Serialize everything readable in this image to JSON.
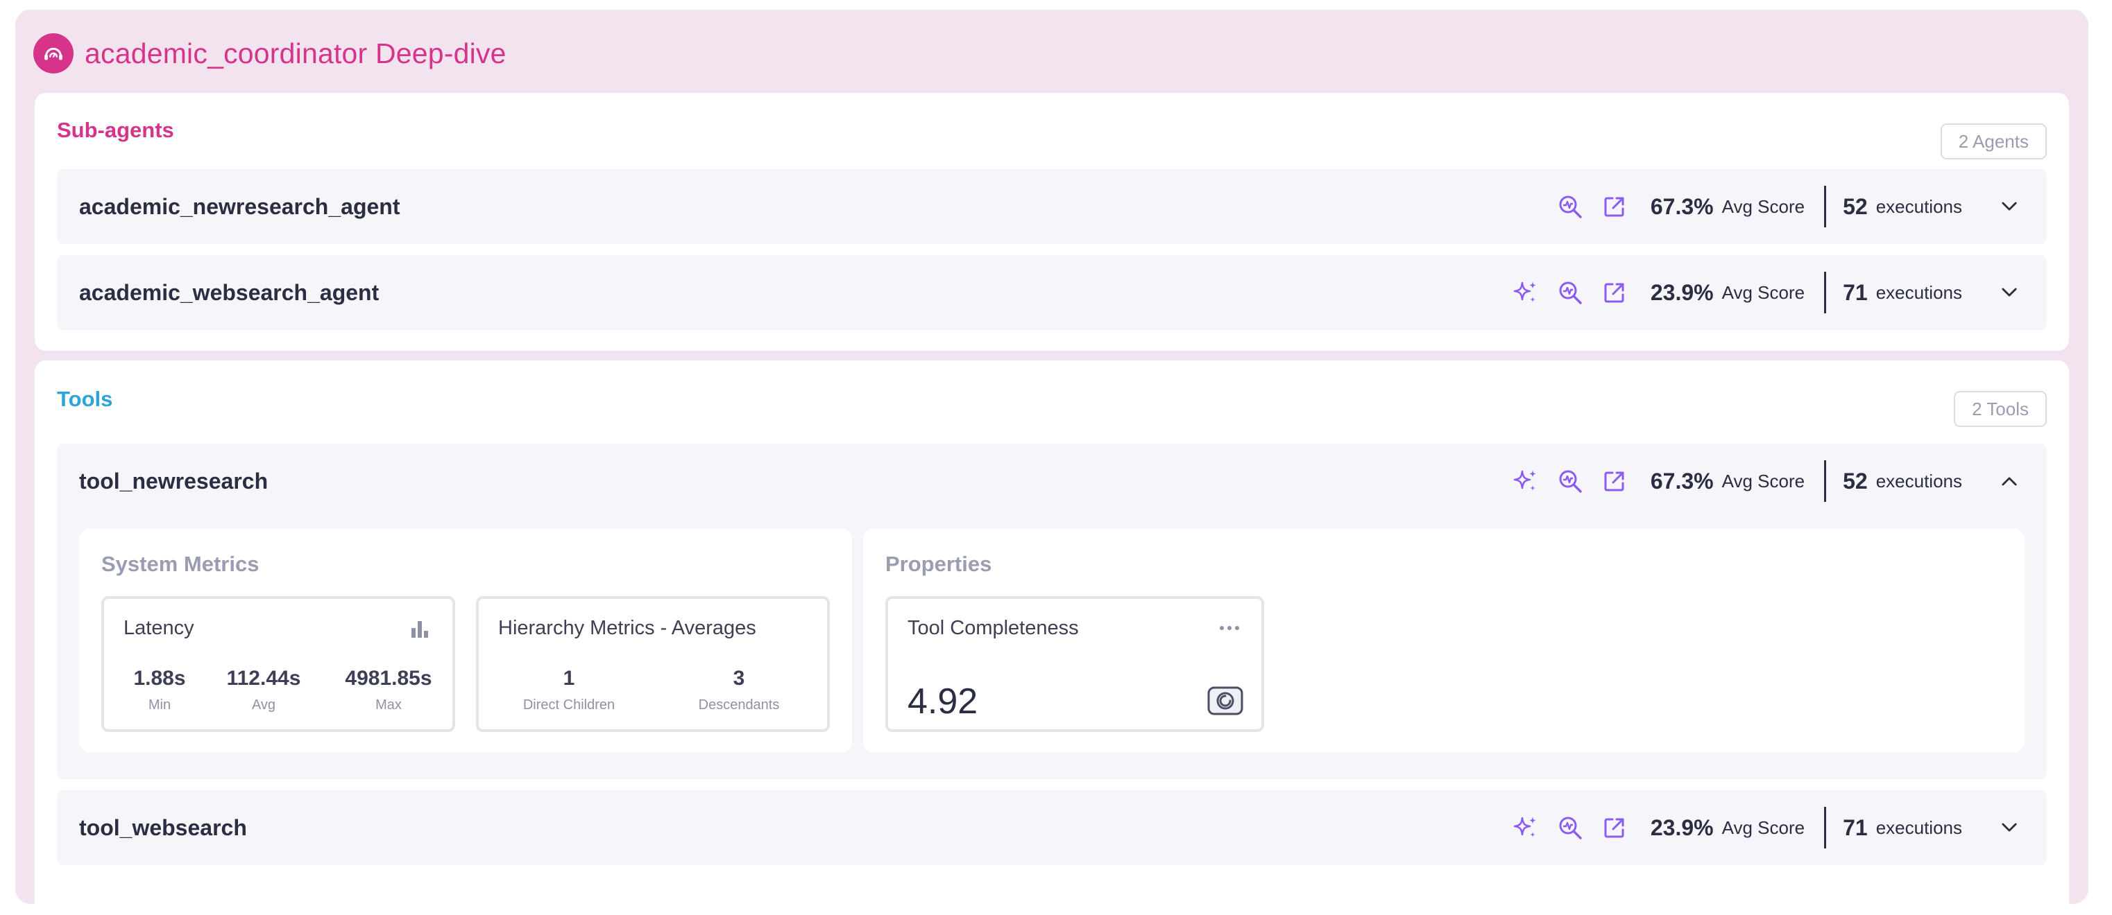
{
  "header": {
    "title": "academic_coordinator Deep-dive",
    "logo_icon": "headset-gauge-icon",
    "accent": "#d6338a"
  },
  "subagents": {
    "title": "Sub-agents",
    "badge": "2 Agents",
    "items": [
      {
        "name": "academic_newresearch_agent",
        "score": "67.3%",
        "score_label": "Avg Score",
        "executions": "52",
        "exec_label": "executions",
        "has_sparkle": false
      },
      {
        "name": "academic_websearch_agent",
        "score": "23.9%",
        "score_label": "Avg Score",
        "executions": "71",
        "exec_label": "executions",
        "has_sparkle": true
      }
    ]
  },
  "tools": {
    "title": "Tools",
    "badge": "2 Tools",
    "accent": "#2ca3d9",
    "items": [
      {
        "name": "tool_newresearch",
        "score": "67.3%",
        "score_label": "Avg Score",
        "executions": "52",
        "exec_label": "executions",
        "expanded": true
      },
      {
        "name": "tool_websearch",
        "score": "23.9%",
        "score_label": "Avg Score",
        "executions": "71",
        "exec_label": "executions",
        "expanded": false
      }
    ],
    "detail": {
      "system_metrics_title": "System Metrics",
      "latency": {
        "title": "Latency",
        "values": [
          {
            "value": "1.88s",
            "label": "Min"
          },
          {
            "value": "112.44s",
            "label": "Avg"
          },
          {
            "value": "4981.85s",
            "label": "Max"
          }
        ]
      },
      "hierarchy": {
        "title": "Hierarchy Metrics - Averages",
        "values": [
          {
            "value": "1",
            "label": "Direct Children"
          },
          {
            "value": "3",
            "label": "Descendants"
          }
        ]
      },
      "properties_title": "Properties",
      "tool_completeness": {
        "title": "Tool Completeness",
        "value": "4.92"
      }
    }
  },
  "icons": [
    "sparkle-icon",
    "inspect-icon",
    "open-external-icon",
    "chevron-down-icon",
    "chevron-up-icon",
    "bar-chart-icon",
    "more-icon",
    "score-badge-icon"
  ],
  "colors": {
    "icon_purple": "#8a5cf0",
    "page_bg": "#f3e3ee",
    "row_bg": "#f5f5fa"
  }
}
